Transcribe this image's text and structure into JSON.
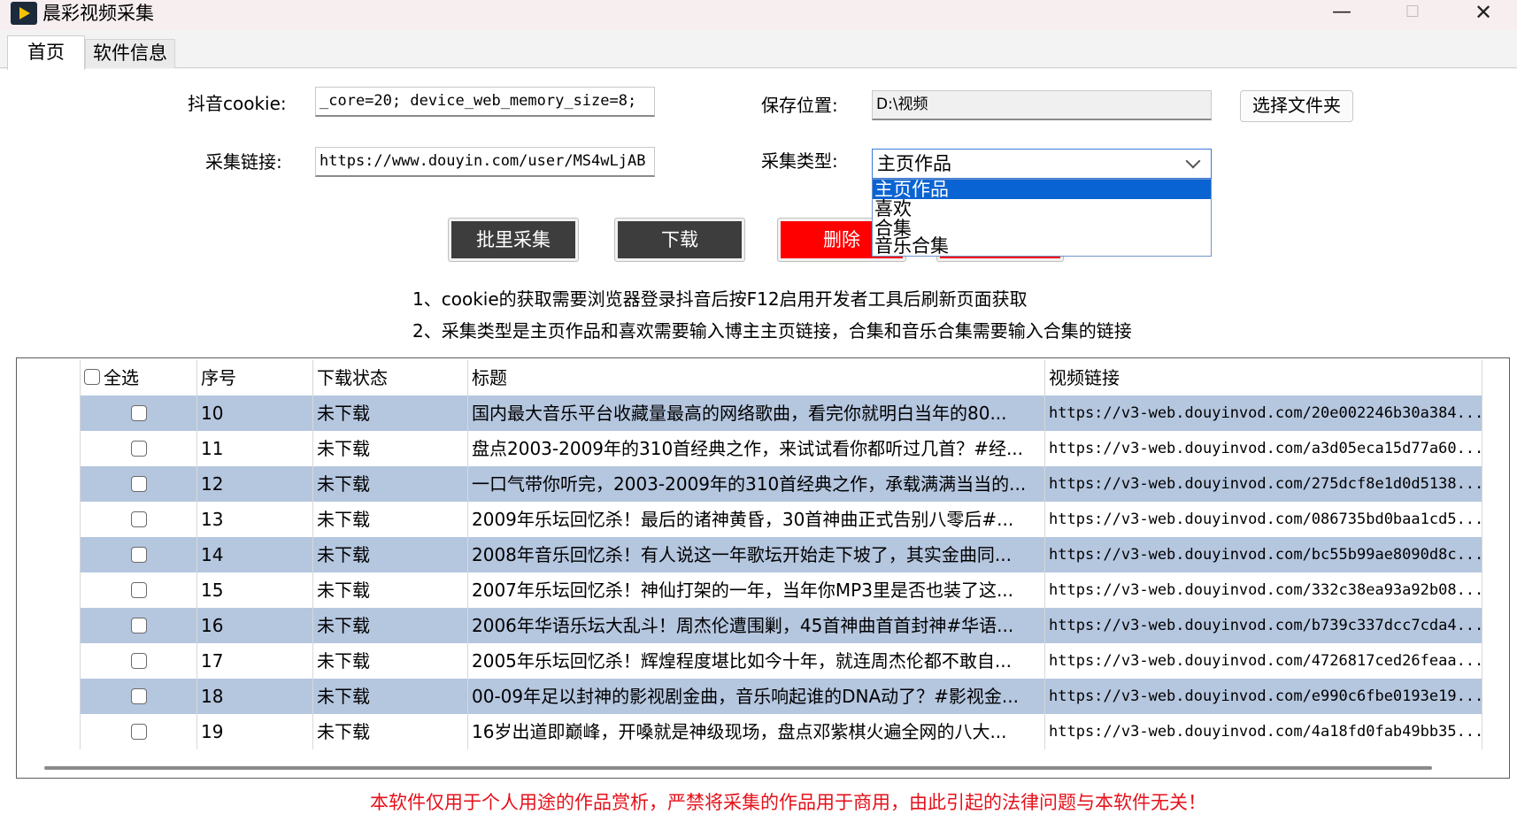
{
  "window": {
    "title": "晨彩视频采集",
    "controls": {
      "minimize": "—",
      "maximize": "☐",
      "close": "✕"
    }
  },
  "tabs": [
    {
      "label": "首页",
      "active": true
    },
    {
      "label": "软件信息",
      "active": false
    }
  ],
  "form": {
    "cookie_label": "抖音cookie:",
    "cookie_value": "_core=20; device_web_memory_size=8;",
    "link_label": "采集链接:",
    "link_value": "https://www.douyin.com/user/MS4wLjAB",
    "save_label": "保存位置:",
    "save_value": "D:\\视频",
    "choose_folder": "选择文件夹",
    "type_label": "采集类型:",
    "type_value": "主页作品",
    "type_options": [
      "主页作品",
      "喜欢",
      "合集",
      "音乐合集"
    ]
  },
  "actions": {
    "batch": "批里采集",
    "download": "下载",
    "delete": "删除"
  },
  "notes": [
    "1、cookie的获取需要浏览器登录抖音后按F12启用开发者工具后刷新页面获取",
    "2、采集类型是主页作品和喜欢需要输入博主主页链接，合集和音乐合集需要输入合集的链接"
  ],
  "table": {
    "headers": {
      "select_all": "全选",
      "index": "序号",
      "status": "下载状态",
      "title": "标题",
      "link": "视频链接"
    },
    "rows": [
      {
        "index": "10",
        "status": "未下载",
        "title": "国内最大音乐平台收藏量最高的网络歌曲，看完你就明白当年的80...",
        "link": "https://v3-web.douyinvod.com/20e002246b30a384..."
      },
      {
        "index": "11",
        "status": "未下载",
        "title": "盘点2003-2009年的310首经典之作，来试试看你都听过几首？#经...",
        "link": "https://v3-web.douyinvod.com/a3d05eca15d77a60..."
      },
      {
        "index": "12",
        "status": "未下载",
        "title": "一口气带你听完，2003-2009年的310首经典之作，承载满满当当的...",
        "link": "https://v3-web.douyinvod.com/275dcf8e1d0d5138..."
      },
      {
        "index": "13",
        "status": "未下载",
        "title": "2009年乐坛回忆杀！最后的诸神黄昏，30首神曲正式告别八零后#...",
        "link": "https://v3-web.douyinvod.com/086735bd0baa1cd5..."
      },
      {
        "index": "14",
        "status": "未下载",
        "title": "2008年音乐回忆杀！有人说这一年歌坛开始走下坡了，其实金曲同...",
        "link": "https://v3-web.douyinvod.com/bc55b99ae8090d8c..."
      },
      {
        "index": "15",
        "status": "未下载",
        "title": "2007年乐坛回忆杀！神仙打架的一年，当年你MP3里是否也装了这...",
        "link": "https://v3-web.douyinvod.com/332c38ea93a92b08..."
      },
      {
        "index": "16",
        "status": "未下载",
        "title": "2006年华语乐坛大乱斗！周杰伦遭围剿，45首神曲首首封神#华语...",
        "link": "https://v3-web.douyinvod.com/b739c337dcc7cda4..."
      },
      {
        "index": "17",
        "status": "未下载",
        "title": "2005年乐坛回忆杀！辉煌程度堪比如今十年，就连周杰伦都不敢自...",
        "link": "https://v3-web.douyinvod.com/4726817ced26feaa..."
      },
      {
        "index": "18",
        "status": "未下载",
        "title": "00-09年足以封神的影视剧金曲，音乐响起谁的DNA动了？#影视金...",
        "link": "https://v3-web.douyinvod.com/e990c6fbe0193e19..."
      },
      {
        "index": "19",
        "status": "未下载",
        "title": "16岁出道即巅峰，开嗓就是神级现场，盘点邓紫棋火遍全网的八大...",
        "link": "https://v3-web.douyinvod.com/4a18fd0fab49bb35..."
      }
    ]
  },
  "disclaimer": "本软件仅用于个人用途的作品赏析，严禁将采集的作品用于商用，由此引起的法律问题与本软件无关！",
  "colors": {
    "row_alt": "#b5c6df",
    "danger": "#ff0000",
    "dark_button": "#3d3d3d",
    "selection": "#0a63d2",
    "disclaimer": "#e4111b"
  }
}
